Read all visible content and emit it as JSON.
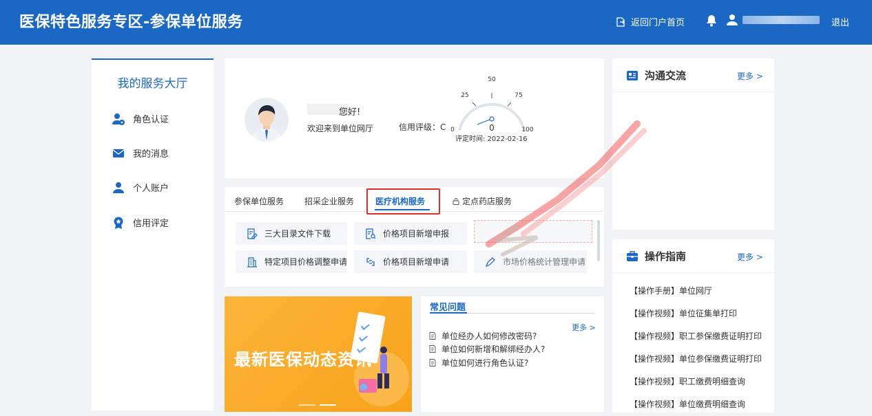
{
  "header": {
    "title": "医保特色服务专区-参保单位服务",
    "home_label": "返回门户首页",
    "logout_label": "退出"
  },
  "sidebar": {
    "title": "我的服务大厅",
    "items": [
      {
        "label": "角色认证",
        "icon": "user-badge-icon"
      },
      {
        "label": "我的消息",
        "icon": "envelope-icon"
      },
      {
        "label": "个人账户",
        "icon": "person-icon"
      },
      {
        "label": "信用评定",
        "icon": "award-icon"
      }
    ]
  },
  "profile": {
    "greeting": "您好!",
    "welcome": "欢迎来到单位网厅",
    "credit_label": "信用评级：C",
    "eval_time": "评定时间: 2022-02-16",
    "gauge": {
      "value": 0,
      "min": 0,
      "max": 100,
      "ticks": [
        "0",
        "25",
        "50",
        "75",
        "100"
      ],
      "value_label": "0"
    }
  },
  "tabs": [
    {
      "label": "参保单位服务",
      "active": false,
      "locked": false
    },
    {
      "label": "招采企业服务",
      "active": false,
      "locked": false
    },
    {
      "label": "医疗机构服务",
      "active": true,
      "locked": false
    },
    {
      "label": "定点药店服务",
      "active": false,
      "locked": true
    }
  ],
  "services": [
    {
      "label": "三大目录文件下载",
      "icon": "document-edit-icon"
    },
    {
      "label": "价格项目新增申报",
      "icon": "document-search-icon"
    },
    {
      "label": "",
      "icon": "redacted"
    },
    {
      "label": "特定项目价格调整申请",
      "icon": "building-icon"
    },
    {
      "label": "价格项目新增申请",
      "icon": "link-icon"
    },
    {
      "label": "市场价格统计管理申请",
      "icon": "pen-icon"
    }
  ],
  "banner": {
    "text": "最新医保动态资讯"
  },
  "faq": {
    "title": "常见问题",
    "more": "更多 >",
    "items": [
      "单位经办人如何修改密码?",
      "单位如何新增和解绑经办人?",
      "单位如何进行角色认证?"
    ]
  },
  "communication": {
    "title": "沟通交流",
    "more": "更多 >"
  },
  "guide": {
    "title": "操作指南",
    "more": "更多 >",
    "items": [
      "【操作手册】单位网厅",
      "【操作视频】单位征集单打印",
      "【操作视频】职工参保缴费证明打印",
      "【操作视频】单位参保缴费证明打印",
      "【操作视频】职工缴费明细查询",
      "【操作视频】单位缴费明细查询"
    ]
  },
  "colors": {
    "primary": "#1b68c4",
    "highlight": "#e02b2b",
    "banner": "#f9a825"
  }
}
